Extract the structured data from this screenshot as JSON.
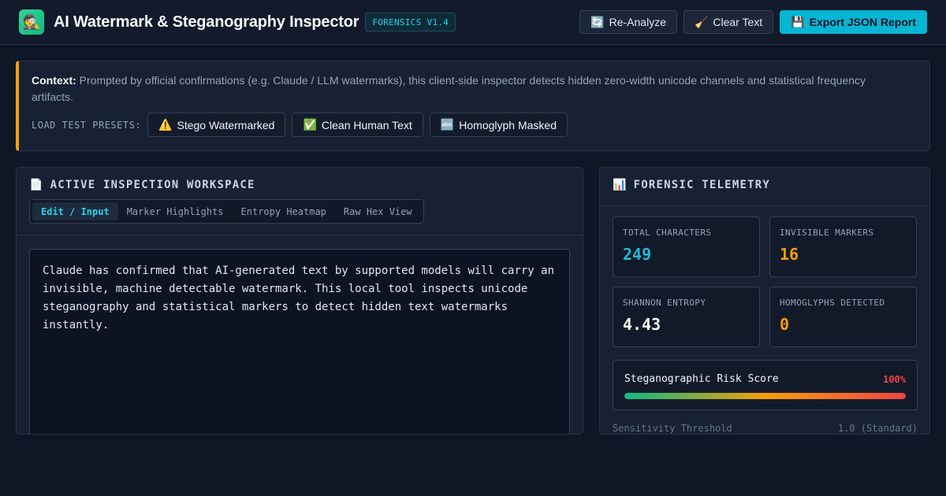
{
  "header": {
    "logo_glyph": "🕵️",
    "title": "AI Watermark & Steganography Inspector",
    "version": "FORENSICS V1.4",
    "buttons": {
      "reanalyze": {
        "icon": "🔄",
        "label": "Re-Analyze"
      },
      "clear": {
        "icon": "🧹",
        "label": "Clear Text"
      },
      "export": {
        "icon": "💾",
        "label": "Export JSON Report"
      }
    }
  },
  "context": {
    "lead": "Context:",
    "text": "Prompted by official confirmations (e.g. Claude / LLM watermarks), this client-side inspector detects hidden zero-width unicode channels and statistical frequency artifacts.",
    "presets_label": "LOAD TEST PRESETS:",
    "presets": [
      {
        "icon": "⚠️",
        "label": "Stego Watermarked"
      },
      {
        "icon": "✅",
        "label": "Clean Human Text"
      },
      {
        "icon": "🔤",
        "label": "Homoglyph Masked"
      }
    ]
  },
  "workspace": {
    "icon": "📄",
    "title": "ACTIVE INSPECTION WORKSPACE",
    "tabs": [
      "Edit / Input",
      "Marker Highlights",
      "Entropy Heatmap",
      "Raw Hex View"
    ],
    "active_tab": "Edit / Input",
    "text": "Claude has confirmed that AI-generated text by supported models will carry an invisible, machine detectable watermark. This local tool inspects unicode steganography and statistical markers to detect hidden text watermarks instantly."
  },
  "telemetry": {
    "icon": "📊",
    "title": "FORENSIC TELEMETRY",
    "stats": [
      {
        "label": "TOTAL CHARACTERS",
        "value": "249",
        "color": "#22b8d8"
      },
      {
        "label": "INVISIBLE MARKERS",
        "value": "16",
        "color": "#f59e0b"
      },
      {
        "label": "SHANNON ENTROPY",
        "value": "4.43",
        "color": "#f8fafc"
      },
      {
        "label": "HOMOGLYPHS DETECTED",
        "value": "0",
        "color": "#f59e0b"
      }
    ],
    "risk": {
      "label": "Steganographic Risk Score",
      "value": "100%",
      "level": 1.0,
      "color": "#ef4444"
    },
    "sensitivity": {
      "label": "Sensitivity Threshold",
      "value": "1.0 (Standard)"
    }
  }
}
